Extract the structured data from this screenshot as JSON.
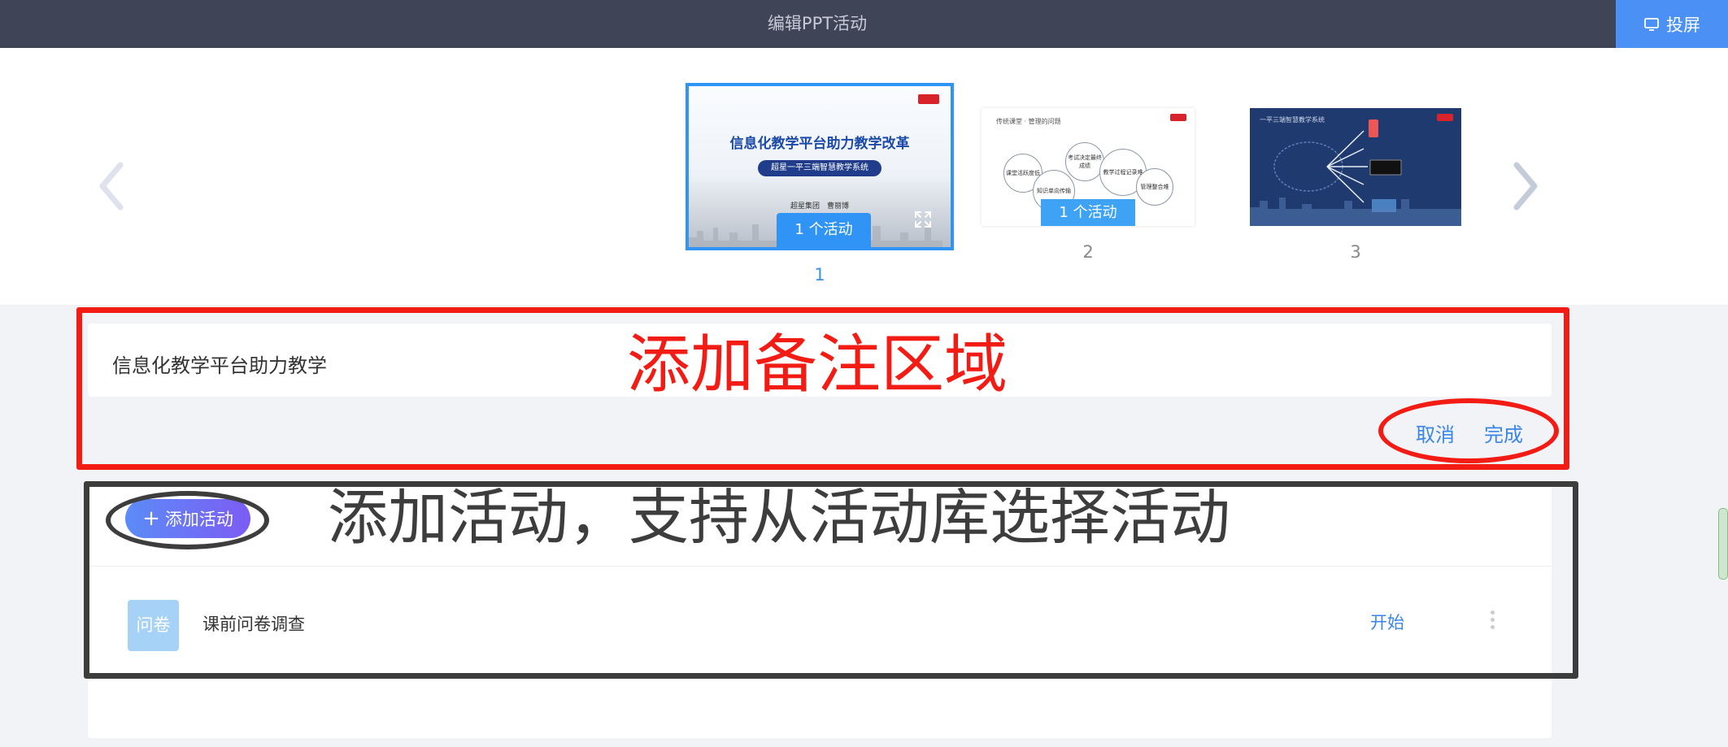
{
  "topbar": {
    "title": "编辑PPT活动",
    "cast_label": "投屏",
    "cast_icon": "monitor-icon"
  },
  "slides": [
    {
      "number": "1",
      "title": "信息化教学平台助力教学改革",
      "subtitle": "超星一平三端智慧教学系统",
      "org": "超星集团　曹丽博",
      "activity_badge": "1 个活动",
      "active": true
    },
    {
      "number": "2",
      "header": "传统课堂 · 管理的问题",
      "bubbles": [
        "课堂活跃度低",
        "考试决定最终成绩",
        "教学过程记录难",
        "知识单向传输",
        "管理整合难"
      ],
      "activity_badge": "1 个活动"
    },
    {
      "number": "3",
      "header": "一平三端智慧教学系统"
    }
  ],
  "notes": {
    "text": "信息化教学平台助力教学",
    "cancel_label": "取消",
    "done_label": "完成"
  },
  "activity": {
    "add_label": "添加活动",
    "items": [
      {
        "icon_label": "问卷",
        "name": "课前问卷调查",
        "start_label": "开始"
      }
    ]
  },
  "annotations": {
    "notes_area": "添加备注区域",
    "activity_area": "添加活动，支持从活动库选择活动"
  },
  "colors": {
    "topbar": "#3f4557",
    "accent": "#2f94f5",
    "link": "#3a86e8",
    "annotation_red": "#f21c14",
    "annotation_dark": "#3d3d3d"
  }
}
